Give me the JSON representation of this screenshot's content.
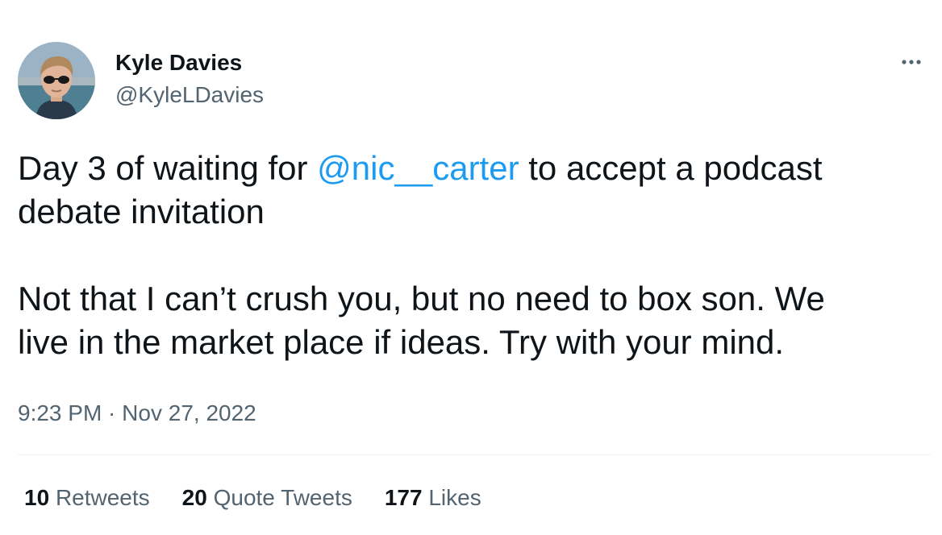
{
  "author": {
    "display_name": "Kyle Davies",
    "handle": "@KyleLDavies"
  },
  "tweet": {
    "text_line1_before": "Day 3 of waiting for ",
    "mention": "@nic__carter",
    "text_line1_after": " to accept a podcast",
    "text_line2": "debate invitation",
    "text_line3": "Not that I can’t crush you, but no need to box son. We",
    "text_line4": "live in the market place if ideas. Try with your mind.",
    "time": "9:23 PM",
    "separator": " · ",
    "date": "Nov 27, 2022"
  },
  "stats": {
    "retweets_count": "10",
    "retweets_label": "Retweets",
    "quotes_count": "20",
    "quotes_label": "Quote Tweets",
    "likes_count": "177",
    "likes_label": "Likes"
  },
  "icons": {
    "more": "more-horizontal-icon"
  },
  "colors": {
    "link": "#1d9bf0",
    "secondary_text": "#536471",
    "primary_text": "#0f1419",
    "divider": "#eff3f4"
  }
}
